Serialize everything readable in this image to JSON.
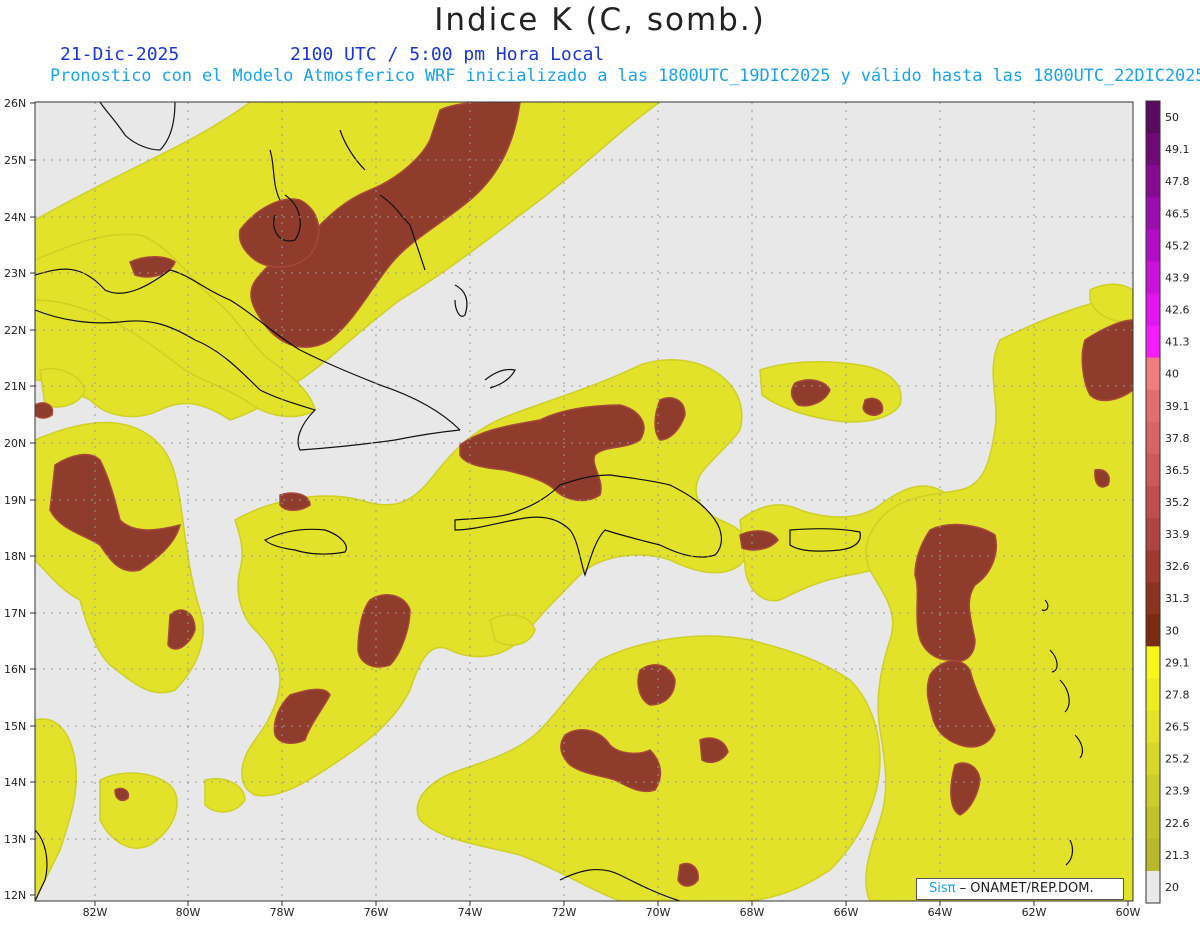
{
  "header": {
    "title": "Indice K (C, somb.)",
    "date": "21-Dic-2025",
    "time": "2100 UTC / 5:00 pm Hora Local",
    "subtitle": "Pronostico con el Modelo Atmosferico WRF inicializado a las 1800UTC_19DIC2025 y válido hasta las  1800UTC_22DIC2025"
  },
  "axes": {
    "lat_labels": [
      "26N",
      "25N",
      "24N",
      "23N",
      "22N",
      "21N",
      "20N",
      "19N",
      "18N",
      "17N",
      "16N",
      "15N",
      "14N",
      "13N",
      "12N"
    ],
    "lon_labels": [
      "82W",
      "80W",
      "78W",
      "76W",
      "74W",
      "72W",
      "70W",
      "68W",
      "66W",
      "64W",
      "62W",
      "60W"
    ]
  },
  "legend": {
    "bins": [
      {
        "label": "50",
        "color": "#5a0a5e"
      },
      {
        "label": "49.1",
        "color": "#6e0a7a"
      },
      {
        "label": "47.8",
        "color": "#860a94"
      },
      {
        "label": "46.5",
        "color": "#9c0cae"
      },
      {
        "label": "45.2",
        "color": "#b20cc6"
      },
      {
        "label": "43.9",
        "color": "#ca12dc"
      },
      {
        "label": "42.6",
        "color": "#e016ee"
      },
      {
        "label": "41.3",
        "color": "#f41cf8"
      },
      {
        "label": "40",
        "color": "#f37c80"
      },
      {
        "label": "39.1",
        "color": "#e46e6e"
      },
      {
        "label": "37.8",
        "color": "#d86464"
      },
      {
        "label": "36.5",
        "color": "#cd5a5a"
      },
      {
        "label": "35.2",
        "color": "#c04e4e"
      },
      {
        "label": "33.9",
        "color": "#b04444"
      },
      {
        "label": "32.6",
        "color": "#a03a30"
      },
      {
        "label": "31.3",
        "color": "#8e3220"
      },
      {
        "label": "30",
        "color": "#7a2c12"
      },
      {
        "label": "29.1",
        "color": "#f7f71a"
      },
      {
        "label": "27.8",
        "color": "#ecec22"
      },
      {
        "label": "26.5",
        "color": "#e2e228"
      },
      {
        "label": "25.2",
        "color": "#d7d72a"
      },
      {
        "label": "23.9",
        "color": "#cccc2a"
      },
      {
        "label": "22.6",
        "color": "#c2c22a"
      },
      {
        "label": "21.3",
        "color": "#b8b82a"
      },
      {
        "label": "20",
        "color": "#e9e9e9"
      }
    ]
  },
  "credit": {
    "brand": "Sisπ",
    "org": "– ONAMET/REP.DOM."
  },
  "colors": {
    "background_field": "#e8e8e8",
    "yellow_field": "#e2e22a",
    "dark_field": "#8f3c2c",
    "coastline": "#111111",
    "grid": "#9a9a9a"
  }
}
